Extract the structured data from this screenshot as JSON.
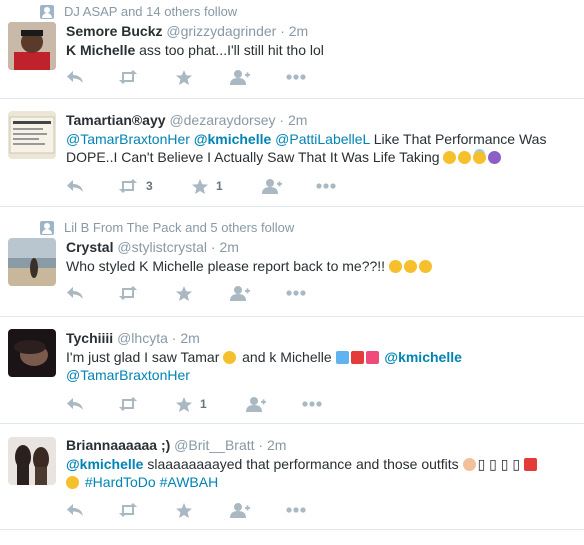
{
  "tweets": [
    {
      "context": "DJ ASAP and 14 others follow",
      "name": "Semore Buckz",
      "handle": "@grizzydagrinder",
      "time": "2m",
      "text_bold": "K Michelle",
      "text_rest": " ass too phat...I'll still hit tho lol"
    },
    {
      "name": "Tamartian®ayy",
      "handle": "@dezaraydorsey",
      "time": "2m",
      "mention1": "@TamarBraxtonHer",
      "mention2": "@kmichelle",
      "mention3": "@PattiLabelleL",
      "text_rest": " Like That Performance Was DOPE..I Can't Believe I Actually Saw That It Was Life Taking",
      "retweets": "3",
      "favorites": "1"
    },
    {
      "context": "Lil B From The Pack and 5 others follow",
      "name": "Crystal",
      "handle": "@stylistcrystal",
      "time": "2m",
      "text": "Who styled K Michelle please report back to me??!! "
    },
    {
      "name": "Tychiiii",
      "handle": "@lhcyta",
      "time": "2m",
      "text_start": "I'm just glad I saw Tamar ",
      "text_mid": " and k Michelle ",
      "mention1": "@kmichelle",
      "mention2": "@TamarBraxtonHer",
      "favorites": "1"
    },
    {
      "name": "Briannaaaaaa ;)",
      "handle": "@Brit__Bratt",
      "time": "2m",
      "mention1": "@kmichelle",
      "text_rest": " slaaaaaaaayed that performance and those outfits ",
      "glyphs": "▯ ▯ ▯ ▯",
      "hashtag1": "#HardToDo",
      "hashtag2": "#AWBAH"
    }
  ],
  "sep": "·",
  "colors": {
    "link": "#0084b4",
    "meta": "#8899a6",
    "icon": "#aab8c2"
  },
  "icons": [
    "reply-icon",
    "retweet-icon",
    "favorite-icon",
    "follow-icon",
    "more-icon",
    "follow-context-icon"
  ]
}
